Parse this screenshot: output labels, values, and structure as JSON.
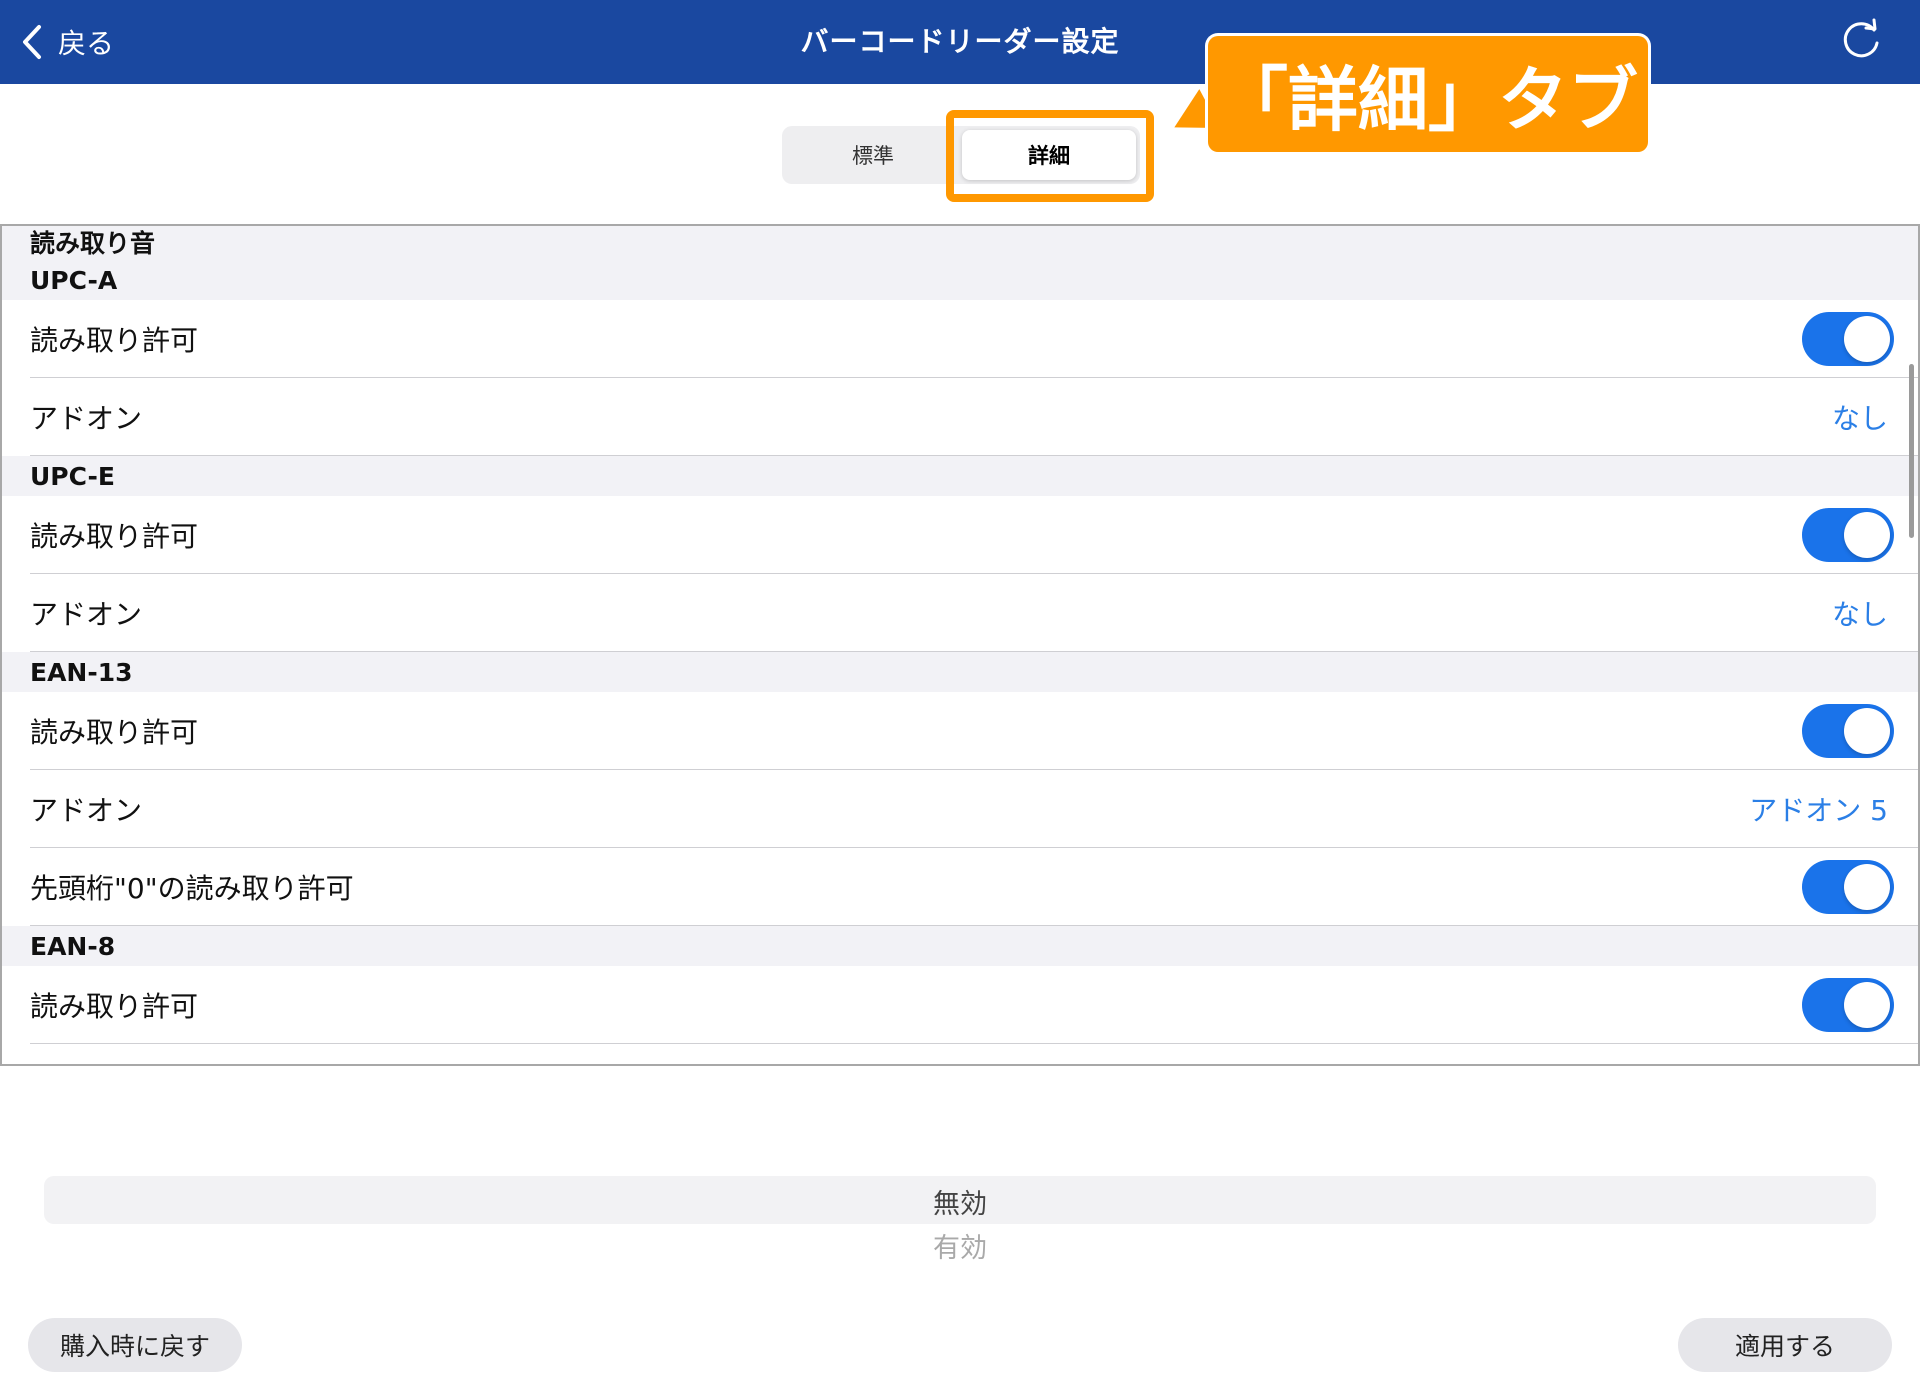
{
  "navbar": {
    "back_label": "戻る",
    "title": "バーコードリーダー設定",
    "color": "#1a48a0",
    "back_icon": "chevron-left-icon",
    "refresh_icon": "refresh-icon"
  },
  "tabs": {
    "standard_label": "標準",
    "detail_label": "詳細",
    "selected": "詳細"
  },
  "annotation": {
    "callout_text": "「詳細」タブ",
    "color": "#ff9800"
  },
  "list": {
    "top_header": "読み取り音",
    "sections": [
      {
        "title": "UPC-A",
        "rows": [
          {
            "label": "読み取り許可",
            "type": "toggle",
            "on": true
          },
          {
            "label": "アドオン",
            "type": "value",
            "value": "なし"
          }
        ]
      },
      {
        "title": "UPC-E",
        "rows": [
          {
            "label": "読み取り許可",
            "type": "toggle",
            "on": true
          },
          {
            "label": "アドオン",
            "type": "value",
            "value": "なし"
          }
        ]
      },
      {
        "title": "EAN-13",
        "rows": [
          {
            "label": "読み取り許可",
            "type": "toggle",
            "on": true
          },
          {
            "label": "アドオン",
            "type": "value",
            "value": "アドオン 5"
          },
          {
            "label": "先頭桁\"0\"の読み取り許可",
            "type": "toggle",
            "on": true
          }
        ]
      },
      {
        "title": "EAN-8",
        "rows": [
          {
            "label": "読み取り許可",
            "type": "toggle",
            "on": true
          }
        ]
      }
    ],
    "toggle_on_color": "#1a73ea",
    "value_color": "#2b7fe6"
  },
  "picker": {
    "selected": "無効",
    "next": "有効"
  },
  "buttons": {
    "reset_label": "購入時に戻す",
    "apply_label": "適用する"
  }
}
